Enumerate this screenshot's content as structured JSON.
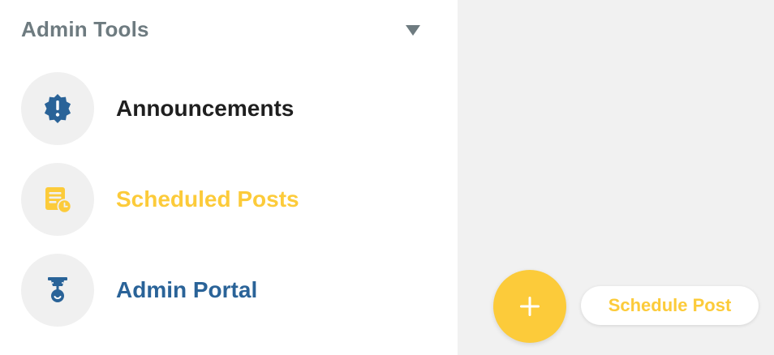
{
  "panel": {
    "title": "Admin Tools",
    "toggle_icon": "chevron-down-icon",
    "items": [
      {
        "label": "Announcements",
        "icon": "announcement-badge-icon",
        "color": "#1f1f1f"
      },
      {
        "label": "Scheduled Posts",
        "icon": "scheduled-post-icon",
        "color": "#fccb3a"
      },
      {
        "label": "Admin Portal",
        "icon": "admin-portal-icon",
        "color": "#2a6398"
      }
    ]
  },
  "fab": {
    "icon": "plus-icon",
    "label": "Schedule Post"
  },
  "colors": {
    "accent_yellow": "#fccb3a",
    "accent_blue": "#2a6398",
    "header_gray": "#6e7b80",
    "icon_bg": "#f0f0f0",
    "page_bg": "#f1f1f1"
  }
}
